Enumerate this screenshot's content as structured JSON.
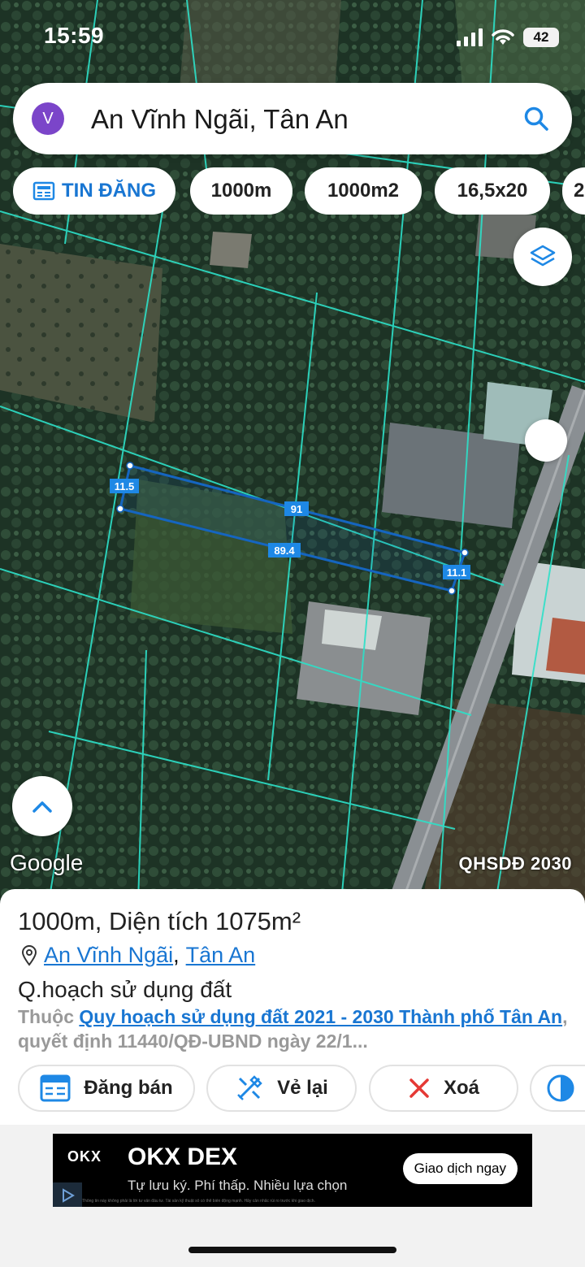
{
  "status_bar": {
    "time": "15:59",
    "battery": "42"
  },
  "search": {
    "avatar_letter": "V",
    "query": "An Vĩnh Ngãi, Tân An"
  },
  "chips": [
    {
      "label": "TIN ĐĂNG",
      "icon": "newspaper-icon"
    },
    {
      "label": "1000m"
    },
    {
      "label": "1000m2"
    },
    {
      "label": "16,5x20"
    },
    {
      "label": "2"
    }
  ],
  "map": {
    "labels": {
      "top": "91",
      "bottom": "89.4",
      "left": "11.5",
      "right": "11.1"
    },
    "attribution": "Google",
    "layer_name": "QHSDĐ 2030",
    "accent_color": "#1565c0",
    "parcel_line_color": "#2de0c8"
  },
  "sheet": {
    "title": "1000m, Diện tích 1075m²",
    "location_parts": [
      "An Vĩnh Ngãi",
      ",",
      "Tân An"
    ],
    "subtitle": "Q.hoạch sử dụng đất",
    "desc_prefix": "Thuộc ",
    "desc_link": "Quy hoạch sử dụng đất 2021 - 2030 Thành phố Tân An",
    "desc_suffix": ", quyết định 11440/QĐ-UBND ngày 22/1..."
  },
  "actions": [
    {
      "label": "Đăng bán",
      "icon": "post-sale-icon"
    },
    {
      "label": "Vẻ lại",
      "icon": "redraw-icon"
    },
    {
      "label": "Xoá",
      "icon": "close-icon"
    },
    {
      "label": "",
      "icon": "contrast-icon"
    }
  ],
  "ad": {
    "logo": "OKX",
    "brand": "OKX DEX",
    "tagline": "Tự lưu ký. Phí thấp. Nhiều lựa chọn",
    "cta": "Giao dịch ngay",
    "fine_print": "Thông tin này không phải là lời tư vấn đầu tư. Tài sản kỹ thuật số có thể biến động mạnh. Hãy cân nhắc rủi ro trước khi giao dịch."
  }
}
